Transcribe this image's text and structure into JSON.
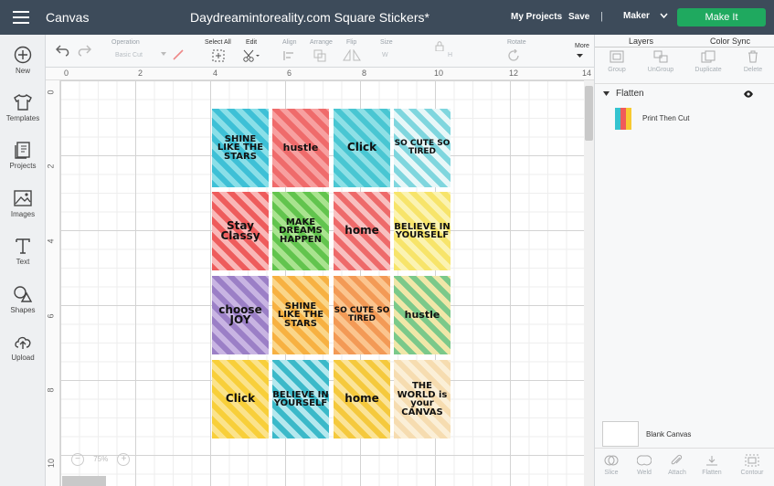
{
  "header": {
    "app_title": "Canvas",
    "doc_title": "Daydreamintoreality.com Square Stickers*",
    "my_projects": "My Projects",
    "save": "Save",
    "separator": "|",
    "machine": "Maker",
    "make_it": "Make It"
  },
  "sidebar": {
    "items": [
      {
        "label": "New",
        "icon": "plus-circle-icon"
      },
      {
        "label": "Templates",
        "icon": "shirt-icon"
      },
      {
        "label": "Projects",
        "icon": "projects-icon"
      },
      {
        "label": "Images",
        "icon": "image-icon"
      },
      {
        "label": "Text",
        "icon": "text-icon"
      },
      {
        "label": "Shapes",
        "icon": "shapes-icon"
      },
      {
        "label": "Upload",
        "icon": "upload-cloud-icon"
      }
    ]
  },
  "toolbar": {
    "operation_label": "Operation",
    "operation_value": "Basic Cut",
    "select_all": "Select All",
    "edit": "Edit",
    "align": "Align",
    "arrange": "Arrange",
    "flip": "Flip",
    "size": "Size",
    "w": "W",
    "h": "H",
    "rotate": "Rotate",
    "more": "More"
  },
  "ruler": {
    "x_ticks": [
      "0",
      "2",
      "4",
      "6",
      "8",
      "10",
      "12",
      "14"
    ],
    "y_ticks": [
      "0",
      "2",
      "4",
      "6",
      "8",
      "10"
    ]
  },
  "canvas": {
    "zoom": "75%",
    "stickers": [
      {
        "text": "SHINE LIKE THE STARS",
        "bg": "#3ec0d6",
        "bg2": "#8adfe8",
        "size": 10
      },
      {
        "text": "hustle",
        "bg": "#ef6b6b",
        "bg2": "#f7a0a0",
        "size": 11
      },
      {
        "text": "Click",
        "bg": "#49c6d2",
        "bg2": "#8ee0e6",
        "size": 12
      },
      {
        "text": "SO CUTE SO TIRED",
        "bg": "#7fd6de",
        "bg2": "#e7f7f8",
        "size": 9
      },
      {
        "text": "Stay Classy",
        "bg": "#ee5c5c",
        "bg2": "#f9b7b7",
        "size": 12
      },
      {
        "text": "MAKE DREAMS HAPPEN",
        "bg": "#62c44e",
        "bg2": "#a9e38f",
        "size": 10
      },
      {
        "text": "home",
        "bg": "#ee6a6a",
        "bg2": "#f8c0c0",
        "size": 12
      },
      {
        "text": "BELIEVE IN YOURSELF",
        "bg": "#f7e46a",
        "bg2": "#fbf3b2",
        "size": 10
      },
      {
        "text": "choose JOY",
        "bg": "#9b7fc6",
        "bg2": "#c8b4e2",
        "size": 12
      },
      {
        "text": "SHINE LIKE THE STARS",
        "bg": "#f7b142",
        "bg2": "#fad68a",
        "size": 10
      },
      {
        "text": "SO CUTE SO TIRED",
        "bg": "#f39a56",
        "bg2": "#fbc58f",
        "size": 9
      },
      {
        "text": "hustle",
        "bg": "#7bc98a",
        "bg2": "#f0e7a8",
        "size": 11
      },
      {
        "text": "Click",
        "bg": "#f8cf3a",
        "bg2": "#fbe38c",
        "size": 12
      },
      {
        "text": "BELIEVE IN YOURSELF",
        "bg": "#3bb9c9",
        "bg2": "#b5e8ee",
        "size": 10
      },
      {
        "text": "home",
        "bg": "#f5c93d",
        "bg2": "#fbe499",
        "size": 12
      },
      {
        "text": "THE WORLD is your CANVAS",
        "bg": "#f6dcb0",
        "bg2": "#fbefd7",
        "size": 10
      }
    ]
  },
  "right_panel": {
    "tab_layers": "Layers",
    "tab_color_sync": "Color Sync",
    "actions": [
      "Group",
      "UnGroup",
      "Duplicate",
      "Delete"
    ],
    "group_name": "Flatten",
    "layer_name": "Print Then Cut",
    "blank_canvas": "Blank Canvas",
    "bottom_actions": [
      "Slice",
      "Weld",
      "Attach",
      "Flatten",
      "Contour"
    ]
  },
  "colors": {
    "topbar": "#3d4b5a",
    "accent": "#1fa95f"
  }
}
